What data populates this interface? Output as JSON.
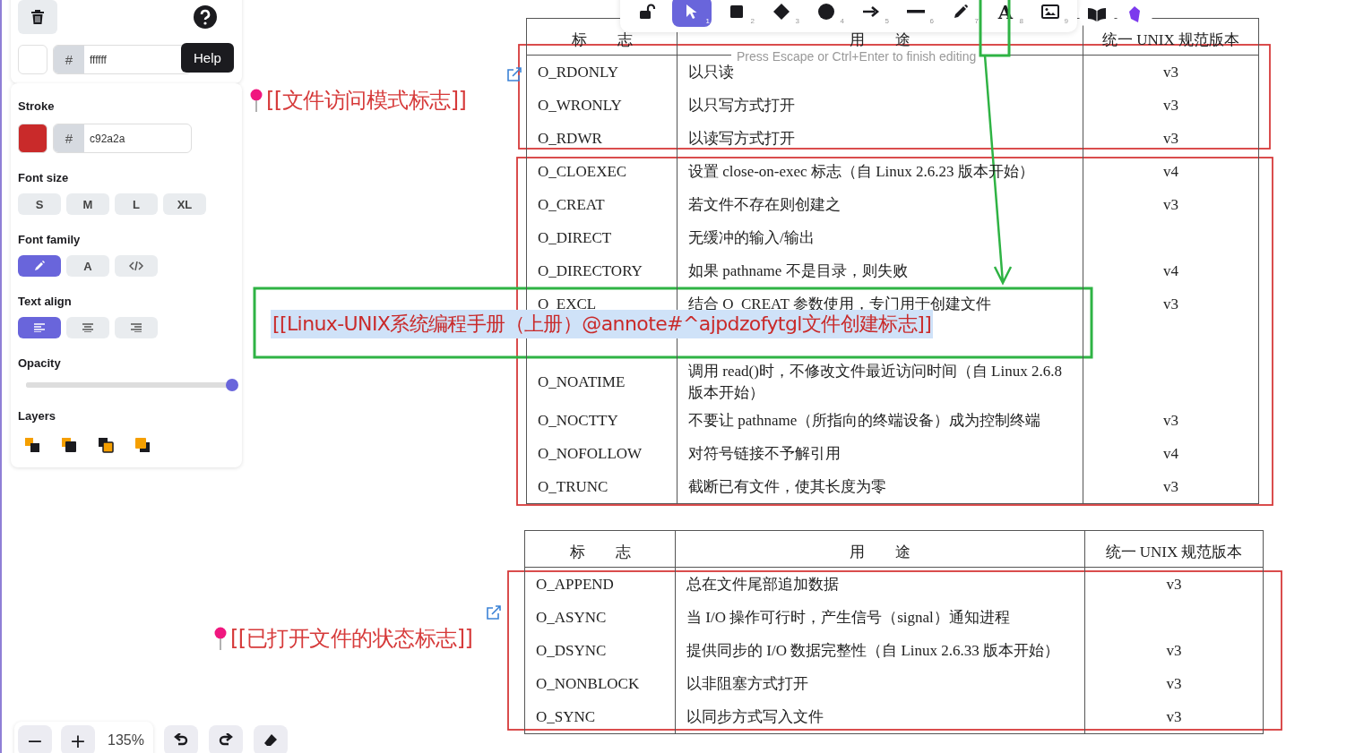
{
  "toolbar": {
    "tools": [
      {
        "kind": "lock",
        "selected": false
      },
      {
        "kind": "select",
        "shortcut": "1",
        "selected": true
      },
      {
        "kind": "rectangle",
        "shortcut": "2",
        "selected": false
      },
      {
        "kind": "diamond",
        "shortcut": "3",
        "selected": false
      },
      {
        "kind": "ellipse",
        "shortcut": "4",
        "selected": false
      },
      {
        "kind": "arrow",
        "shortcut": "5",
        "selected": false
      },
      {
        "kind": "line",
        "shortcut": "6",
        "selected": false
      },
      {
        "kind": "draw",
        "shortcut": "7",
        "selected": false
      },
      {
        "kind": "text",
        "glyph": "A",
        "shortcut": "8",
        "selected": false
      },
      {
        "kind": "image",
        "shortcut": "9",
        "selected": false
      }
    ],
    "extras": [
      {
        "kind": "library"
      },
      {
        "kind": "plugin"
      }
    ]
  },
  "hint": "Press Escape or Ctrl+Enter to finish editing",
  "properties": {
    "tooltip": "Help",
    "background": {
      "hash": "#",
      "value": "ffffff"
    },
    "stroke": {
      "label": "Stroke",
      "hash": "#",
      "value": "c92a2a"
    },
    "font_size": {
      "label": "Font size",
      "options": [
        {
          "label": "S",
          "selected": false
        },
        {
          "label": "M",
          "selected": false
        },
        {
          "label": "L",
          "selected": false
        },
        {
          "label": "XL",
          "selected": false
        }
      ]
    },
    "font_family": {
      "label": "Font family",
      "options": [
        {
          "kind": "hand",
          "selected": true
        },
        {
          "kind": "normal",
          "glyph": "A",
          "selected": false
        },
        {
          "kind": "code",
          "selected": false
        }
      ]
    },
    "text_align": {
      "label": "Text align",
      "options": [
        {
          "kind": "left",
          "selected": true
        },
        {
          "kind": "center",
          "selected": false
        },
        {
          "kind": "right",
          "selected": false
        }
      ]
    },
    "opacity": {
      "label": "Opacity",
      "level": 1
    },
    "layers": {
      "label": "Layers",
      "actions": [
        {
          "kind": "back"
        },
        {
          "kind": "backward"
        },
        {
          "kind": "forward"
        },
        {
          "kind": "front"
        }
      ]
    }
  },
  "zoom": {
    "out": "−",
    "in": "+",
    "value": "135%"
  },
  "canvas": {
    "labels": [
      {
        "text": "[[文件访问模式标志]]"
      },
      {
        "text": "[[已打开文件的状态标志]]"
      }
    ],
    "editing": {
      "text": "[[Linux-UNIX系统编程手册（上册）@annote#^ajpdzofytgl文件创建标志]]"
    },
    "tables": [
      {
        "columns": [
          "标　　志",
          "用　　途",
          "统一 UNIX 规范版本"
        ],
        "rows": [
          {
            "flag": "O_RDONLY",
            "use": "以只读",
            "version": "v3"
          },
          {
            "flag": "O_WRONLY",
            "use": "以只写方式打开",
            "version": "v3"
          },
          {
            "flag": "O_RDWR",
            "use": "以读写方式打开",
            "version": "v3"
          },
          {
            "flag": "O_CLOEXEC",
            "use": "设置 close-on-exec 标志（自 Linux 2.6.23 版本开始）",
            "version": "v4"
          },
          {
            "flag": "O_CREAT",
            "use": "若文件不存在则创建之",
            "version": "v3"
          },
          {
            "flag": "O_DIRECT",
            "use": "无缓冲的输入/输出"
          },
          {
            "flag": "O_DIRECTORY",
            "use": "如果 pathname 不是目录，则失败",
            "version": "v4"
          },
          {
            "flag": "O_EXCL",
            "use": "结合 O_CREAT 参数使用，专门用于创建文件",
            "version": "v3"
          },
          {
            "kind": "covered"
          },
          {
            "flag": "O_NOATIME",
            "use": "调用 read()时，不修改文件最近访问时间（自 Linux 2.6.8 版本开始）"
          },
          {
            "flag": "O_NOCTTY",
            "use": "不要让 pathname（所指向的终端设备）成为控制终端",
            "version": "v3"
          },
          {
            "flag": "O_NOFOLLOW",
            "use": "对符号链接不予解引用",
            "version": "v4"
          },
          {
            "flag": "O_TRUNC",
            "use": "截断已有文件，使其长度为零",
            "version": "v3"
          }
        ]
      },
      {
        "columns": [
          "标　　志",
          "用　　途",
          "统一 UNIX 规范版本"
        ],
        "rows": [
          {
            "flag": "O_APPEND",
            "use": "总在文件尾部追加数据",
            "version": "v3"
          },
          {
            "flag": "O_ASYNC",
            "use": "当 I/O 操作可行时，产生信号（signal）通知进程"
          },
          {
            "flag": "O_DSYNC",
            "use": "提供同步的 I/O 数据完整性（自 Linux 2.6.33 版本开始）",
            "version": "v3"
          },
          {
            "flag": "O_NONBLOCK",
            "use": "以非阻塞方式打开",
            "version": "v3"
          },
          {
            "flag": "O_SYNC",
            "use": "以同步方式写入文件",
            "version": "v3"
          }
        ]
      }
    ]
  }
}
